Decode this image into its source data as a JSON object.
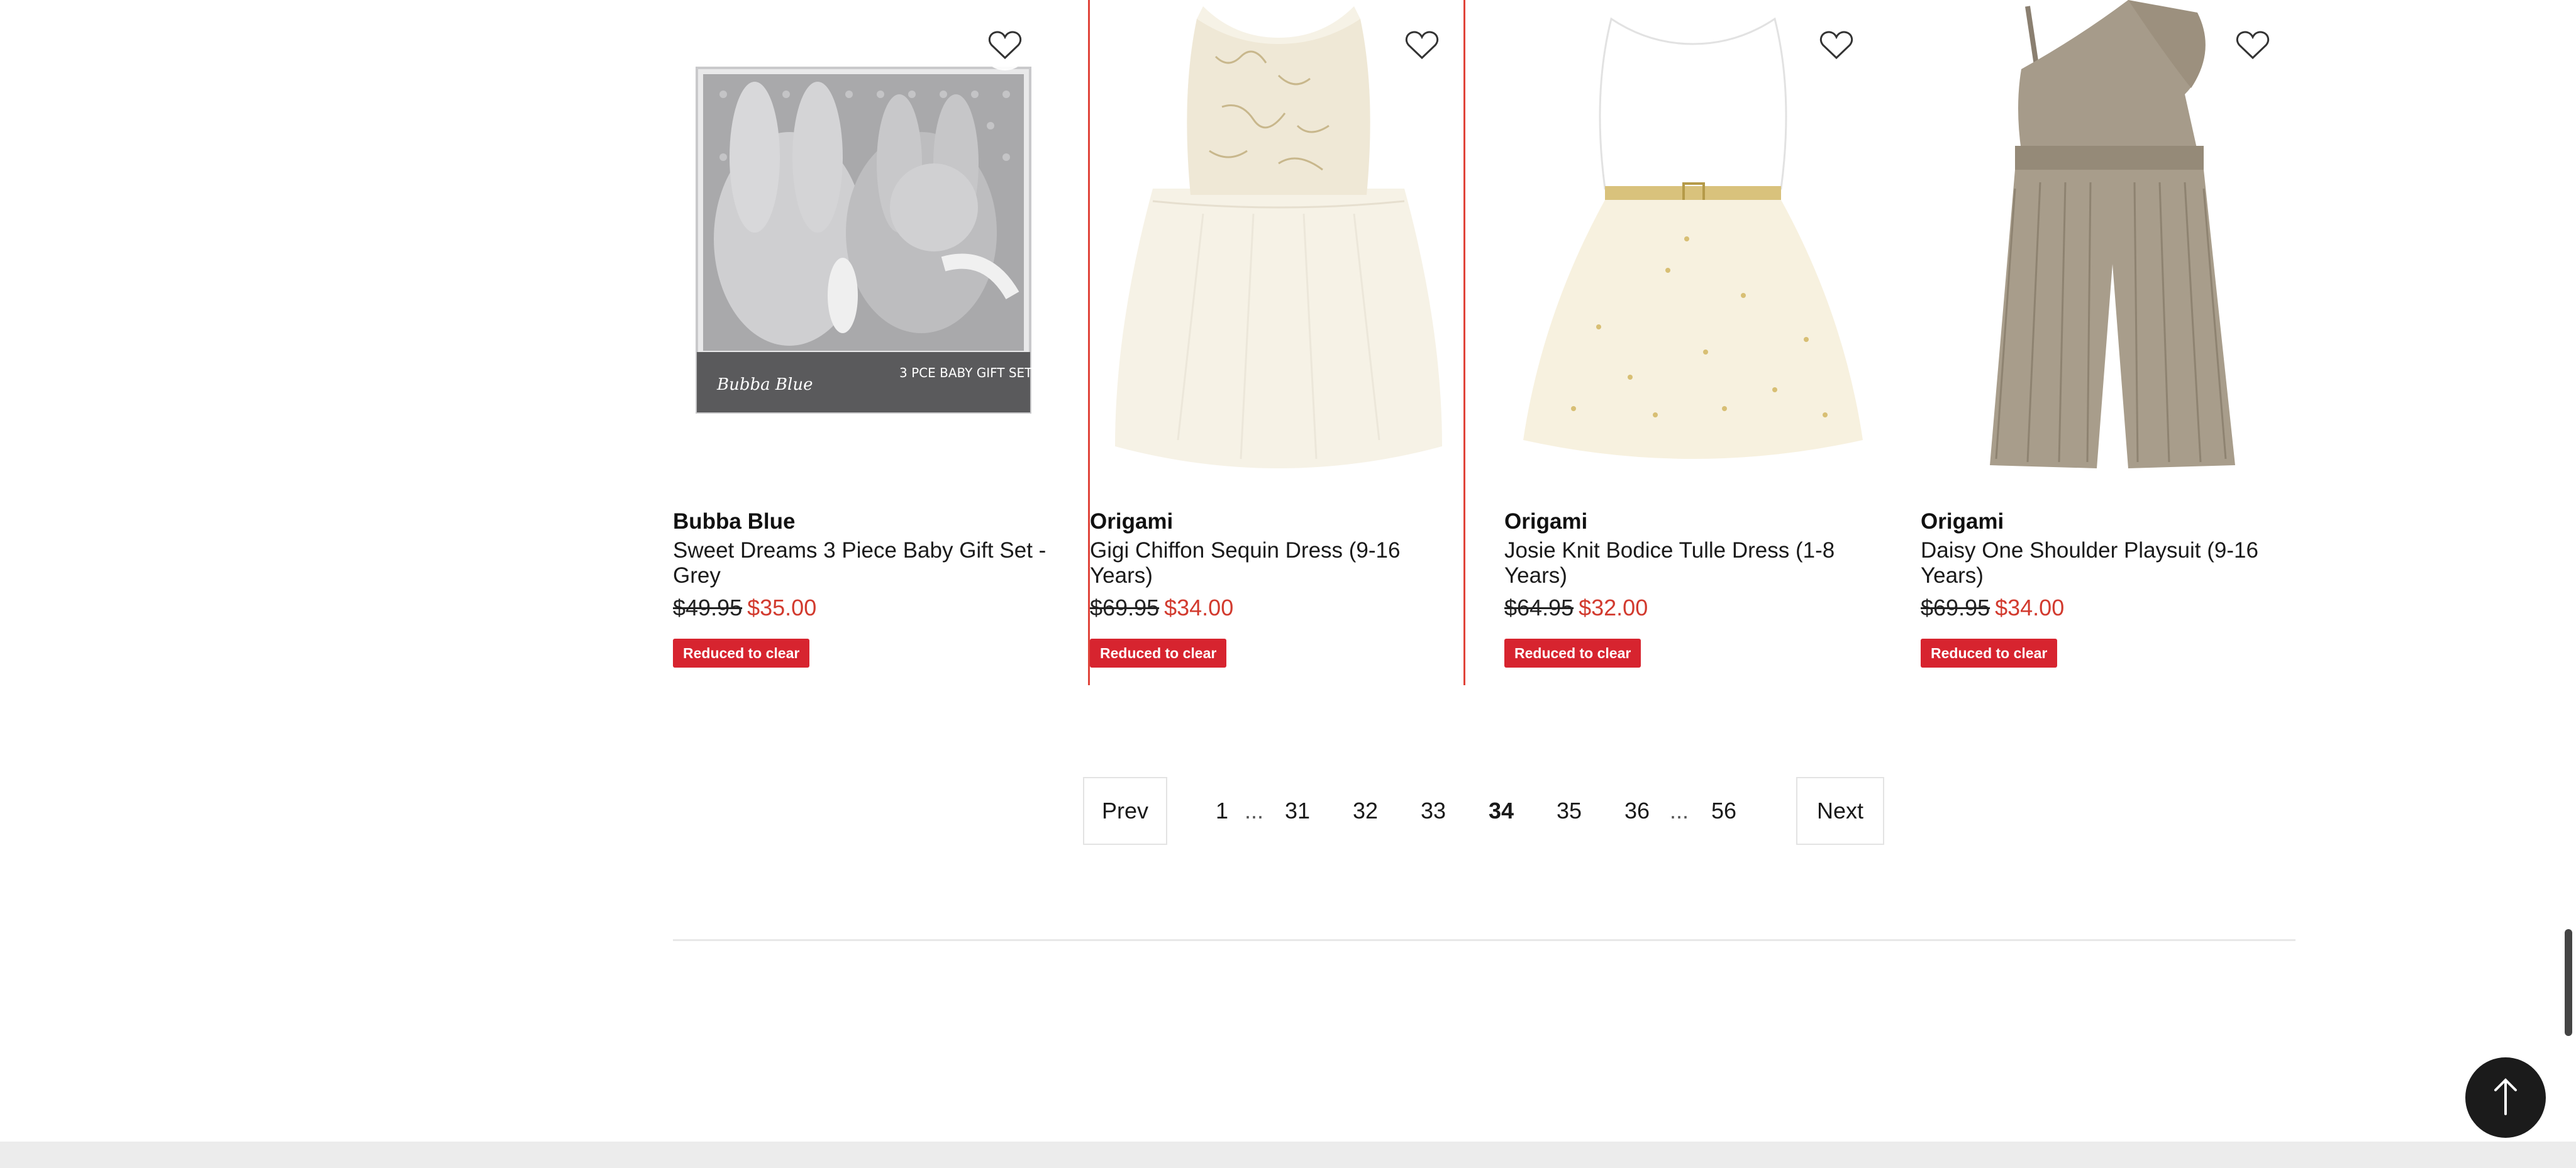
{
  "products": [
    {
      "brand": "Bubba Blue",
      "title": "Sweet Dreams 3 Piece Baby Gift Set - Grey",
      "was_price": "$49.95",
      "now_price": "$35.00",
      "badge": "Reduced to clear",
      "image_icon": "baby-gift-set-image",
      "wishlist_icon": "heart-outline-icon",
      "packaging_text": "Bubba Blue",
      "packaging_subtext": "3 PCE BABY GIFT SET"
    },
    {
      "brand": "Origami",
      "title": "Gigi Chiffon Sequin Dress (9-16 Years)",
      "was_price": "$69.95",
      "now_price": "$34.00",
      "badge": "Reduced to clear",
      "image_icon": "sequin-dress-image",
      "wishlist_icon": "heart-outline-icon"
    },
    {
      "brand": "Origami",
      "title": "Josie Knit Bodice Tulle Dress (1-8 Years)",
      "was_price": "$64.95",
      "now_price": "$32.00",
      "badge": "Reduced to clear",
      "image_icon": "tulle-dress-image",
      "wishlist_icon": "heart-outline-icon"
    },
    {
      "brand": "Origami",
      "title": "Daisy One Shoulder Playsuit (9-16 Years)",
      "was_price": "$69.95",
      "now_price": "$34.00",
      "badge": "Reduced to clear",
      "image_icon": "playsuit-image",
      "wishlist_icon": "heart-outline-icon"
    }
  ],
  "pagination": {
    "prev_label": "Prev",
    "next_label": "Next",
    "pages": [
      "1",
      "31",
      "32",
      "33",
      "34",
      "35",
      "36",
      "56"
    ],
    "current": "34",
    "ellipsis": "..."
  },
  "back_to_top_icon": "arrow-up-icon",
  "colors": {
    "sale_price": "#d23a2e",
    "badge_bg": "#d7242f",
    "selected_border": "#e0443a",
    "back_to_top_bg": "#1b1b1b"
  }
}
